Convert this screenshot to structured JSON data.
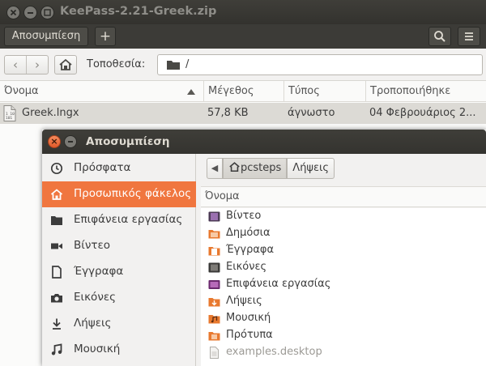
{
  "window": {
    "title": "KeePass-2.21-Greek.zip"
  },
  "toolbar": {
    "extract_label": "Αποσυμπίεση",
    "add_label": "+"
  },
  "location": {
    "label": "Τοποθεσία:",
    "path": "/"
  },
  "columns": {
    "name": "Όνομα",
    "size": "Μέγεθος",
    "type": "Τύπος",
    "modified": "Τροποποιήθηκε"
  },
  "files": [
    {
      "name": "Greek.lngx",
      "size": "57,8 KB",
      "type": "άγνωστο",
      "modified": "04 Φεβρουάριος 2..."
    }
  ],
  "dialog": {
    "title": "Αποσυμπίεση",
    "sidebar": [
      {
        "label": "Πρόσφατα",
        "icon": "clock-icon"
      },
      {
        "label": "Προσωπικός φάκελος",
        "icon": "home-icon",
        "active": true
      },
      {
        "label": "Επιφάνεια εργασίας",
        "icon": "desktop-folder-icon"
      },
      {
        "label": "Βίντεο",
        "icon": "video-icon"
      },
      {
        "label": "Έγγραφα",
        "icon": "document-icon"
      },
      {
        "label": "Εικόνες",
        "icon": "camera-icon"
      },
      {
        "label": "Λήψεις",
        "icon": "download-icon"
      },
      {
        "label": "Μουσική",
        "icon": "music-icon"
      }
    ],
    "pathbar": {
      "current": "pcsteps",
      "next": "Λήψεις"
    },
    "list_header": "Όνομα",
    "items": [
      {
        "label": "Βίντεο",
        "icon": "video-folder-icon"
      },
      {
        "label": "Δημόσια",
        "icon": "public-folder-icon"
      },
      {
        "label": "Έγγραφα",
        "icon": "documents-folder-icon"
      },
      {
        "label": "Εικόνες",
        "icon": "pictures-folder-icon"
      },
      {
        "label": "Επιφάνεια εργασίας",
        "icon": "desktop-folder-icon"
      },
      {
        "label": "Λήψεις",
        "icon": "downloads-folder-icon"
      },
      {
        "label": "Μουσική",
        "icon": "music-folder-icon"
      },
      {
        "label": "Πρότυπα",
        "icon": "templates-folder-icon"
      },
      {
        "label": "examples.desktop",
        "icon": "file-icon",
        "dimmed": true
      }
    ]
  },
  "colors": {
    "accent": "#f0763f",
    "titlebar": "#3c3b37",
    "selection_row": "#dcdad5"
  }
}
